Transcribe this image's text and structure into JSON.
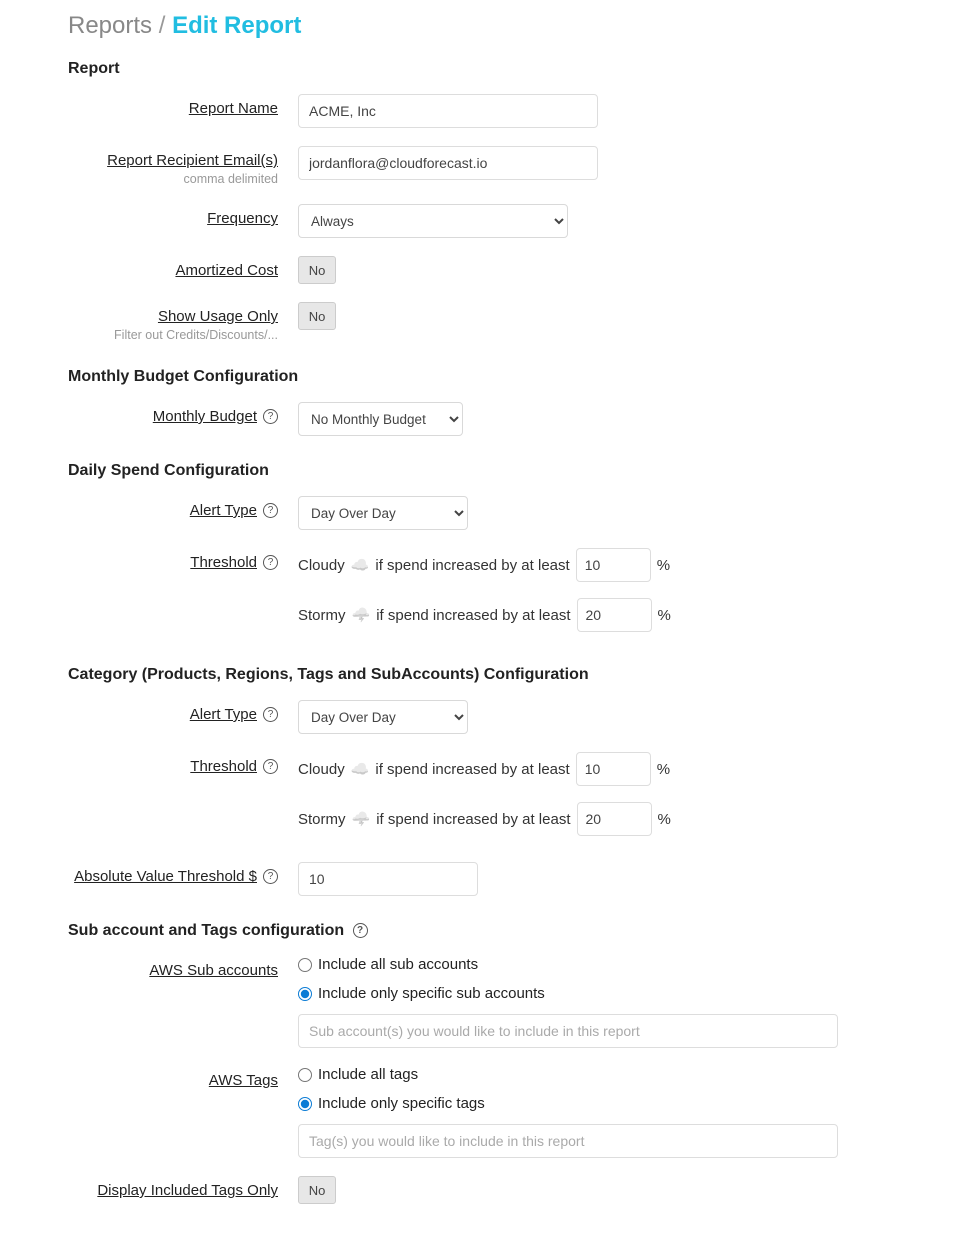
{
  "breadcrumb": {
    "parent": "Reports",
    "sep": " / ",
    "current": "Edit Report"
  },
  "sections": {
    "report": "Report",
    "monthly": "Monthly Budget Configuration",
    "daily": "Daily Spend Configuration",
    "category": "Category (Products, Regions, Tags and SubAccounts) Configuration",
    "subtags": "Sub account and Tags configuration"
  },
  "labels": {
    "report_name": "Report Name",
    "recipient": "Report Recipient Email(s)",
    "recipient_sub": "comma delimited",
    "frequency": "Frequency",
    "amortized": "Amortized Cost",
    "usage_only": "Show Usage Only",
    "usage_only_sub": "Filter out Credits/Discounts/...",
    "monthly_budget": "Monthly Budget",
    "alert_type": "Alert Type",
    "threshold": "Threshold",
    "abs_value": "Absolute Value Threshold $",
    "aws_sub": "AWS Sub accounts",
    "aws_tags": "AWS Tags",
    "display_tags": "Display Included Tags Only"
  },
  "values": {
    "report_name": "ACME, Inc",
    "recipient": "jordanflora@cloudforecast.io",
    "frequency": "Always",
    "amortized": "No",
    "usage_only": "No",
    "monthly_budget": "No Monthly Budget",
    "daily_alert_type": "Day Over Day",
    "daily_cloudy": "10",
    "daily_stormy": "20",
    "cat_alert_type": "Day Over Day",
    "cat_cloudy": "10",
    "cat_stormy": "20",
    "abs_value": "10",
    "sub_radio_all": "Include all sub accounts",
    "sub_radio_specific": "Include only specific sub accounts",
    "tags_radio_all": "Include all tags",
    "tags_radio_specific": "Include only specific tags",
    "display_tags": "No"
  },
  "threshold_text": {
    "cloudy_prefix": "Cloudy",
    "stormy_prefix": "Stormy",
    "suffix": " if spend increased by at least",
    "pct": "%"
  },
  "placeholders": {
    "sub_accounts": "Sub account(s) you would like to include in this report",
    "tags": "Tag(s) you would like to include in this report"
  }
}
